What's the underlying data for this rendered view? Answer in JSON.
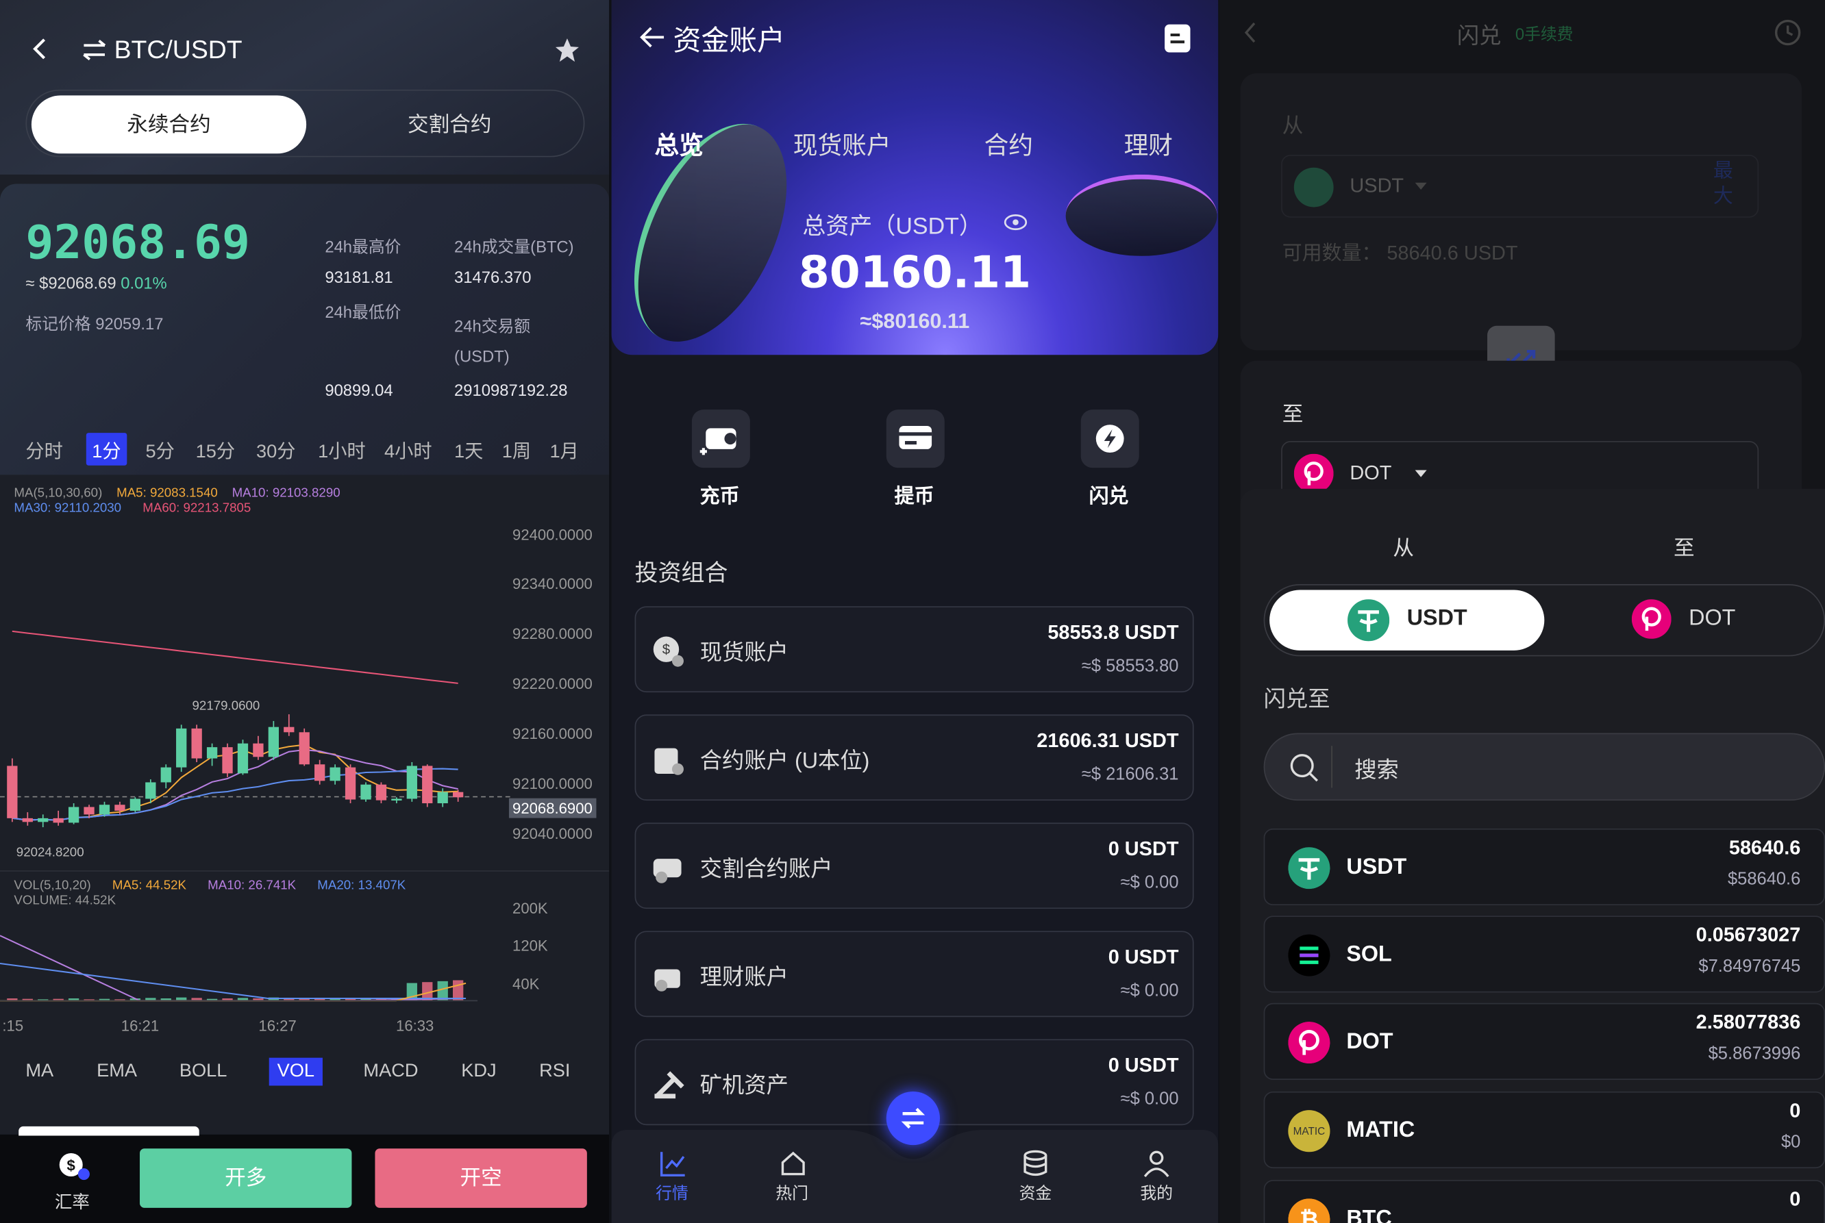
{
  "p1": {
    "pair": "BTC/USDT",
    "tabs": [
      "永续合约",
      "交割合约"
    ],
    "price": "92068.69",
    "usd_price": "≈ $92068.69",
    "change": "0.01%",
    "mark_price": "标记价格 92059.17",
    "high_label": "24h最高价",
    "high_value": "93181.81",
    "low_label": "24h最低价",
    "low_value": "90899.04",
    "vol_label": "24h成交量(BTC)",
    "vol_value": "31476.370",
    "turnover_label1": "24h交易额",
    "turnover_label2": "(USDT)",
    "turnover_value": "2910987192.28",
    "timeframes": [
      "分时",
      "1分",
      "5分",
      "15分",
      "30分",
      "1小时",
      "4小时",
      "1天",
      "1周",
      "1月"
    ],
    "ma_line1": {
      "base": "MA(5,10,30,60)",
      "ma5": "MA5: 92083.1540",
      "ma10": "MA10: 92103.8290"
    },
    "ma_line2": {
      "ma30": "MA30: 92110.2030",
      "ma60": "MA60: 92213.7805"
    },
    "y_labels": [
      "92400.0000",
      "92340.0000",
      "92280.0000",
      "92220.0000",
      "92160.0000",
      "92100.0000",
      "92040.0000"
    ],
    "current_price_tag": "92068.6900",
    "high_marker": "92179.0600",
    "low_marker": "92024.8200",
    "vol_line1": {
      "base": "VOL(5,10,20)",
      "ma5": "MA5: 44.52K",
      "ma10": "MA10: 26.741K",
      "ma20": "MA20: 13.407K"
    },
    "vol_line2": "VOLUME: 44.52K",
    "vol_y": [
      "200K",
      "120K",
      "40K"
    ],
    "time_labels": [
      ":15",
      "16:21",
      "16:27",
      "16:33"
    ],
    "indicators": [
      "MA",
      "EMA",
      "BOLL",
      "VOL",
      "MACD",
      "KDJ",
      "RSI"
    ],
    "rate_label": "汇率",
    "long_btn": "开多",
    "short_btn": "开空"
  },
  "p2": {
    "title": "资金账户",
    "tabs": [
      "总览",
      "现货账户",
      "合约",
      "理财"
    ],
    "total_label": "总资产（USDT）",
    "total_value": "80160.11",
    "total_usd": "≈$80160.11",
    "actions": [
      "充币",
      "提币",
      "闪兑"
    ],
    "section": "投资组合",
    "accounts": [
      {
        "name": "现货账户",
        "v1": "58553.8 USDT",
        "v2": "≈$ 58553.80"
      },
      {
        "name": "合约账户 (U本位)",
        "v1": "21606.31 USDT",
        "v2": "≈$ 21606.31"
      },
      {
        "name": "交割合约账户",
        "v1": "0 USDT",
        "v2": "≈$ 0.00"
      },
      {
        "name": "理财账户",
        "v1": "0 USDT",
        "v2": "≈$ 0.00"
      },
      {
        "name": "矿机资产",
        "v1": "0 USDT",
        "v2": "≈$ 0.00"
      }
    ],
    "nav": [
      "行情",
      "热门",
      "资金",
      "我的"
    ]
  },
  "p3": {
    "title": "闪兑",
    "fee": "0手续费",
    "from_label": "从",
    "from_coin": "USDT",
    "max": "最大",
    "available": "可用数量：  58640.6 USDT",
    "to_label": "至",
    "to_coin": "DOT",
    "sheet_tabs": [
      "从",
      "至"
    ],
    "sheet_seg": [
      "USDT",
      "DOT"
    ],
    "flash_to": "闪兑至",
    "search_placeholder": "搜索",
    "coins": [
      {
        "name": "USDT",
        "amount": "58640.6",
        "usd": "$58640.6"
      },
      {
        "name": "SOL",
        "amount": "0.05673027",
        "usd": "$7.84976745"
      },
      {
        "name": "DOT",
        "amount": "2.58077836",
        "usd": "$5.8673996"
      },
      {
        "name": "MATIC",
        "amount": "0",
        "usd": "$0"
      },
      {
        "name": "BTC",
        "amount": "0",
        "usd": ""
      }
    ],
    "matic_logo_text": "MATIC"
  },
  "colors": {
    "up": "#5ccfa3",
    "down": "#e86b84",
    "accent": "#3d4bff",
    "price": "#58d6ac"
  },
  "chart_data": {
    "type": "candlestick",
    "ylim": [
      92020,
      92420
    ],
    "y_ticks": [
      92400,
      92340,
      92280,
      92220,
      92160,
      92100,
      92040
    ],
    "current": 92068.69,
    "high": 92179.06,
    "low": 92024.82,
    "candles_ohlc": [
      [
        92110,
        92120,
        92035,
        92040
      ],
      [
        92040,
        92048,
        92030,
        92035
      ],
      [
        92035,
        92045,
        92028,
        92040
      ],
      [
        92040,
        92050,
        92030,
        92034
      ],
      [
        92034,
        92060,
        92032,
        92055
      ],
      [
        92055,
        92058,
        92040,
        92045
      ],
      [
        92045,
        92062,
        92042,
        92058
      ],
      [
        92058,
        92062,
        92045,
        92050
      ],
      [
        92050,
        92068,
        92048,
        92066
      ],
      [
        92066,
        92092,
        92060,
        92088
      ],
      [
        92088,
        92112,
        92080,
        92108
      ],
      [
        92108,
        92165,
        92102,
        92160
      ],
      [
        92160,
        92165,
        92115,
        92120
      ],
      [
        92120,
        92140,
        92110,
        92135
      ],
      [
        92135,
        92140,
        92095,
        92100
      ],
      [
        92100,
        92145,
        92098,
        92140
      ],
      [
        92140,
        92150,
        92118,
        92122
      ],
      [
        92122,
        92170,
        92118,
        92162
      ],
      [
        92162,
        92179,
        92150,
        92155
      ],
      [
        92155,
        92160,
        92110,
        92112
      ],
      [
        92112,
        92118,
        92085,
        92090
      ],
      [
        92090,
        92112,
        92085,
        92108
      ],
      [
        92108,
        92112,
        92060,
        92065
      ],
      [
        92065,
        92088,
        92062,
        92085
      ],
      [
        92085,
        92088,
        92060,
        92064
      ],
      [
        92064,
        92068,
        92060,
        92066
      ],
      [
        92066,
        92115,
        92062,
        92110
      ],
      [
        92110,
        92112,
        92055,
        92060
      ],
      [
        92060,
        92080,
        92055,
        92075
      ],
      [
        92075,
        92078,
        92062,
        92068
      ]
    ],
    "volume_k": [
      5,
      4,
      3,
      4,
      5,
      3,
      4,
      3,
      5,
      6,
      5,
      7,
      6,
      4,
      5,
      6,
      5,
      7,
      6,
      5,
      4,
      5,
      6,
      5,
      4,
      5,
      38,
      40,
      42,
      44
    ]
  }
}
